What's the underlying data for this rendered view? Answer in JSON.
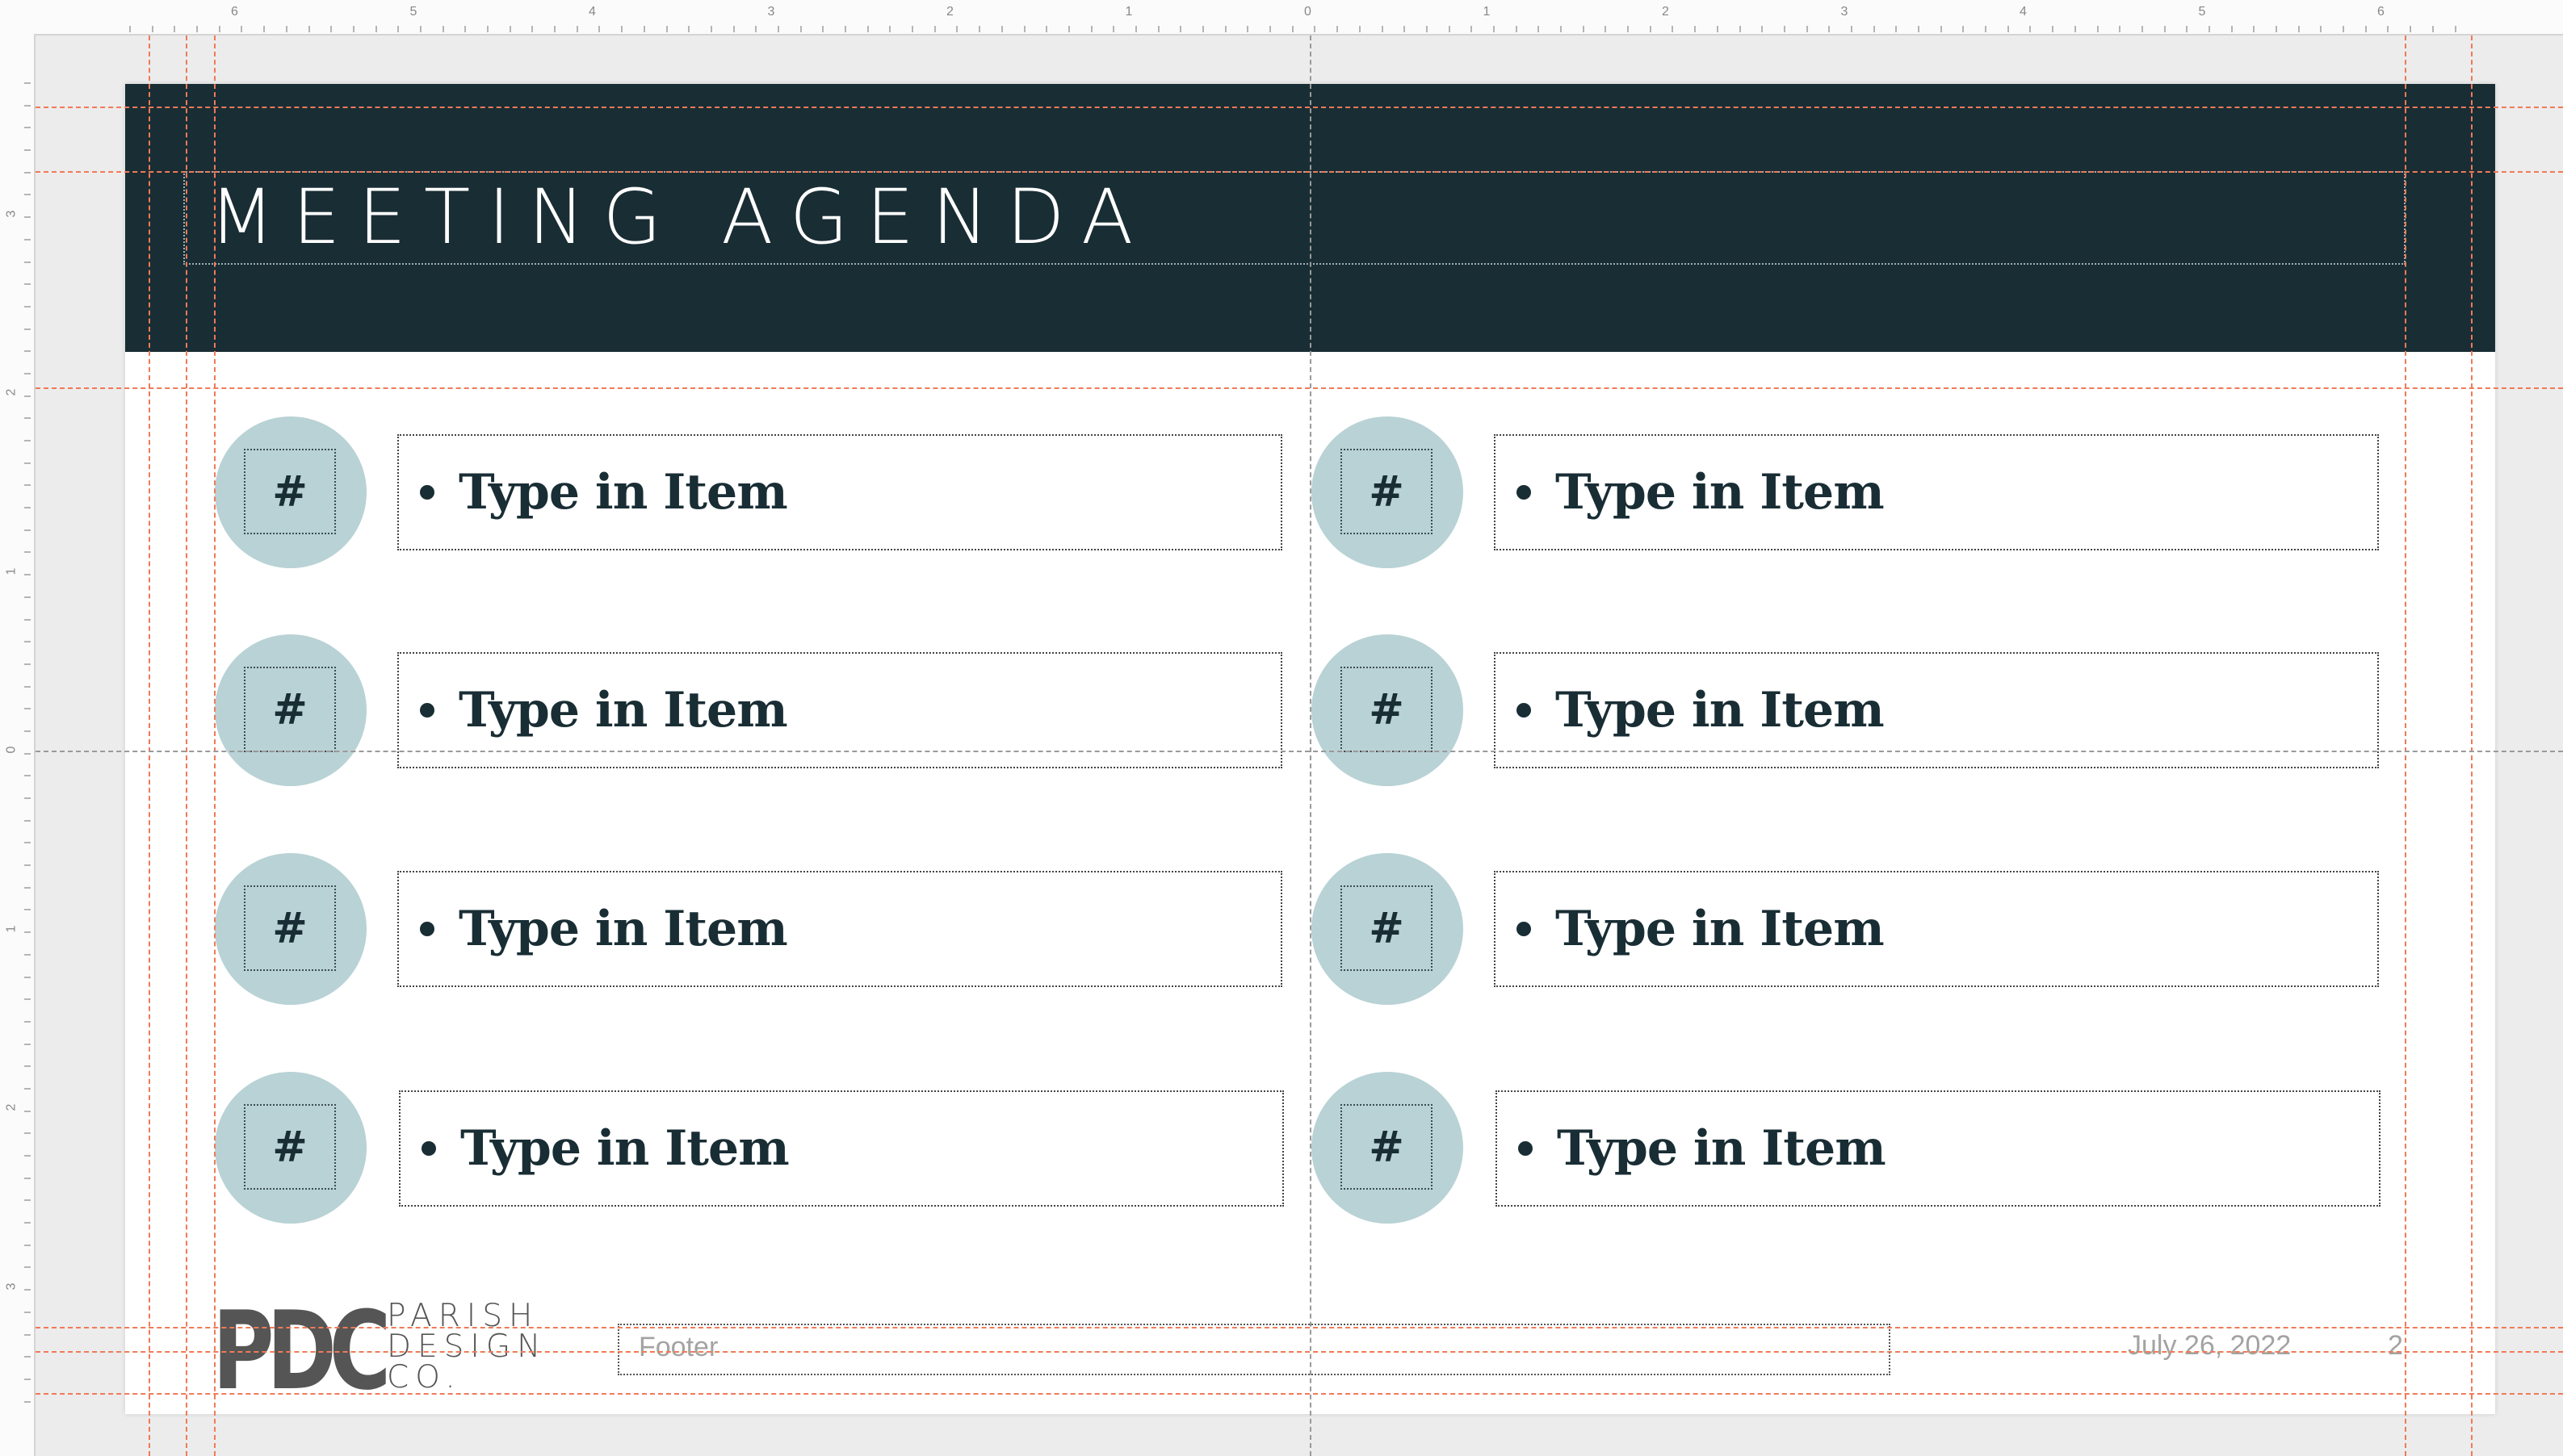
{
  "rulers": {
    "top_labels": [
      "6",
      "5",
      "4",
      "3",
      "2",
      "1",
      "0",
      "1",
      "2",
      "3",
      "4",
      "5",
      "6"
    ],
    "left_labels": [
      "3",
      "2",
      "1",
      "0",
      "1",
      "2",
      "3"
    ]
  },
  "slide": {
    "title": "MEETING AGENDA",
    "items_left": [
      {
        "number": "#",
        "text": "Type in Item"
      },
      {
        "number": "#",
        "text": "Type in Item"
      },
      {
        "number": "#",
        "text": "Type in Item"
      },
      {
        "number": "#",
        "text": "Type in Item"
      }
    ],
    "items_right": [
      {
        "number": "#",
        "text": "Type in Item"
      },
      {
        "number": "#",
        "text": "Type in Item"
      },
      {
        "number": "#",
        "text": "Type in Item"
      },
      {
        "number": "#",
        "text": "Type in Item"
      }
    ],
    "logo": {
      "mark": "PDC",
      "line1": "PARISH",
      "line2": "DESIGN",
      "line3": "CO."
    },
    "footer": {
      "text": "Footer",
      "date": "July 26, 2022",
      "page": "2"
    }
  },
  "colors": {
    "header_band": "#192d34",
    "circle": "#b9d2d5",
    "guide": "#f07a58",
    "text_dark": "#192d34"
  }
}
